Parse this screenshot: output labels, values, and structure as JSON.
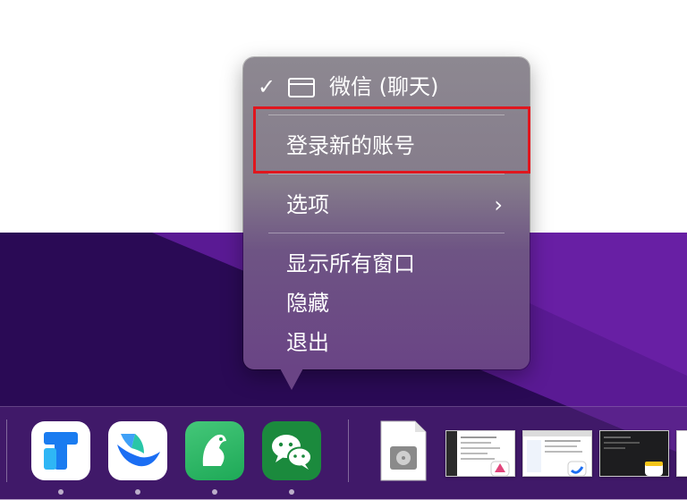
{
  "context_menu": {
    "window_item": {
      "check": "✓",
      "label": "微信 (聊天)"
    },
    "login_new_account": "登录新的账号",
    "options": {
      "label": "选项",
      "chevron": "›"
    },
    "show_all_windows": "显示所有窗口",
    "hide": "隐藏",
    "quit": "退出"
  },
  "highlight": {
    "color": "#e0161e"
  },
  "dock": {
    "apps": [
      {
        "icon": "tencent-meeting-icon",
        "running": true
      },
      {
        "icon": "lark-feishu-icon",
        "running": true
      },
      {
        "icon": "green-bird-app-icon",
        "running": true
      },
      {
        "icon": "wechat-icon",
        "running": true
      }
    ],
    "recent": [
      "disk-image-document-icon",
      "window-thumbnail",
      "window-thumbnail",
      "window-thumbnail",
      "window-thumbnail"
    ]
  },
  "colors": {
    "wallpaper": "#4a1383",
    "wechat_green": "#1b8a3d",
    "tencent_blue": "#1a7cf0"
  }
}
